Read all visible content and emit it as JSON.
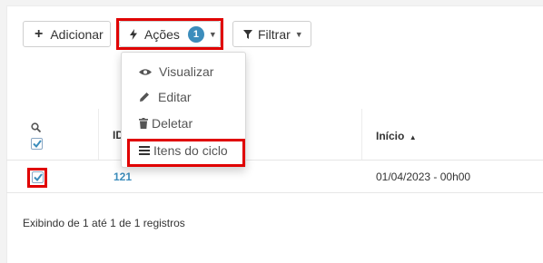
{
  "toolbar": {
    "add_label": "Adicionar",
    "actions_label": "Ações",
    "actions_badge": "1",
    "filter_label": "Filtrar"
  },
  "actions_menu": {
    "items": [
      {
        "label": "Visualizar",
        "icon": "eye-icon"
      },
      {
        "label": "Editar",
        "icon": "pencil-icon"
      },
      {
        "label": "Deletar",
        "icon": "trash-icon"
      },
      {
        "label": "Itens do ciclo",
        "icon": "list-icon"
      }
    ]
  },
  "table": {
    "columns": [
      "ID",
      "Início"
    ],
    "rows": [
      {
        "id": "121",
        "inicio": "01/04/2023 - 00h00",
        "selected": true
      }
    ]
  },
  "footer": {
    "text": "Exibindo de 1 até 1 de 1 registros"
  },
  "colors": {
    "highlight": "#e00000",
    "accent": "#3c8dbc"
  }
}
